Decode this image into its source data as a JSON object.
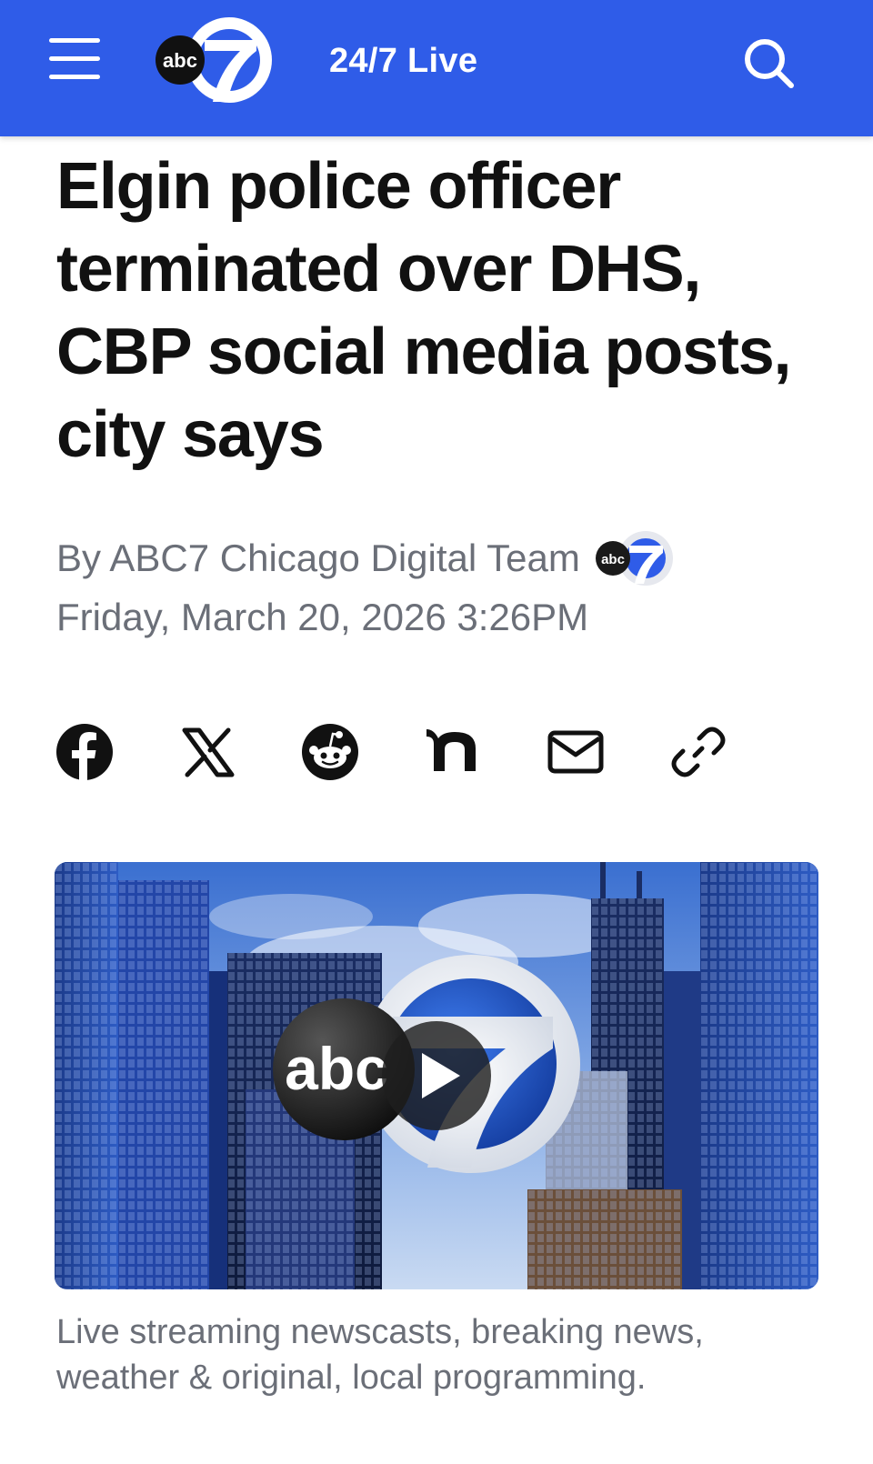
{
  "header": {
    "menu_icon": "hamburger-menu-icon",
    "logo_text": "abc",
    "logo_number": "7",
    "live_label": "24/7 Live",
    "search_icon": "search-icon",
    "bg_color": "#2f5ce8"
  },
  "article": {
    "headline": "Elgin police officer terminated over DHS, CBP social media posts, city says",
    "byline": "By ABC7 Chicago Digital Team",
    "date": "Friday, March 20, 2026 3:26PM"
  },
  "share": {
    "icons": [
      "facebook-icon",
      "x-icon",
      "reddit-icon",
      "nextdoor-icon",
      "email-icon",
      "copy-link-icon"
    ]
  },
  "video": {
    "logo_text": "abc",
    "play_icon": "play-icon",
    "caption": "Live streaming newscasts, breaking news, weather & original, local programming."
  }
}
